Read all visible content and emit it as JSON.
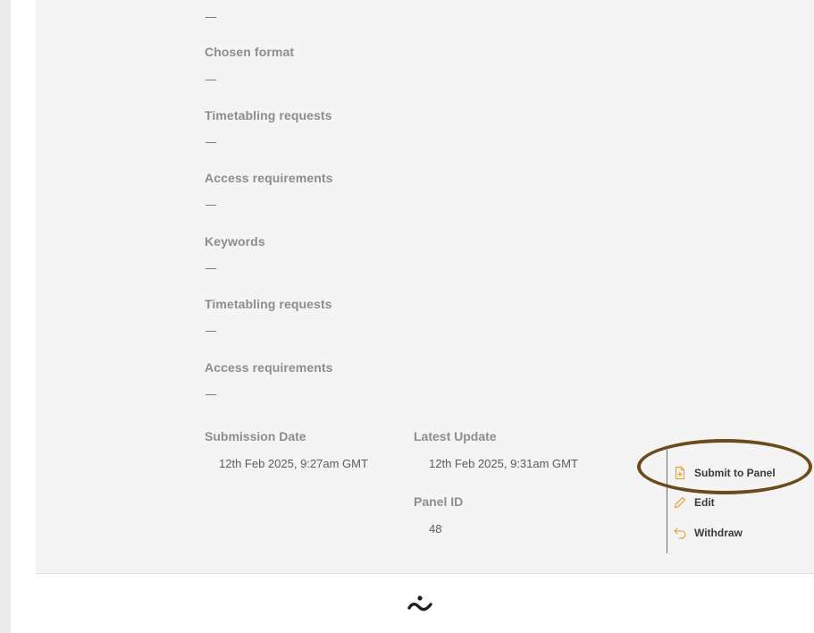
{
  "fields": [
    {
      "label": "",
      "value": "—"
    },
    {
      "label": "Chosen format",
      "value": "—"
    },
    {
      "label": "Timetabling requests",
      "value": "—"
    },
    {
      "label": "Access requirements",
      "value": "—"
    },
    {
      "label": "Keywords",
      "value": "—"
    },
    {
      "label": "Timetabling requests",
      "value": "—"
    },
    {
      "label": "Access requirements",
      "value": "—"
    }
  ],
  "meta": {
    "submission_date_label": "Submission Date",
    "submission_date_value": "12th Feb 2025, 9:27am GMT",
    "latest_update_label": "Latest Update",
    "latest_update_value": "12th Feb 2025, 9:31am GMT",
    "panel_id_label": "Panel ID",
    "panel_id_value": "48"
  },
  "actions": [
    {
      "label": "Submit to Panel",
      "icon": "document-plus-icon"
    },
    {
      "label": "Edit",
      "icon": "pencil-icon"
    },
    {
      "label": "Withdraw",
      "icon": "undo-arrow-icon"
    }
  ],
  "colors": {
    "accent": "#e8a33a",
    "highlight": "#6b4a1c",
    "panel_bg": "#f4f4f4",
    "label_gray": "#8d8d8d"
  },
  "footer": {
    "logo_icon": "brand-logo-icon"
  }
}
